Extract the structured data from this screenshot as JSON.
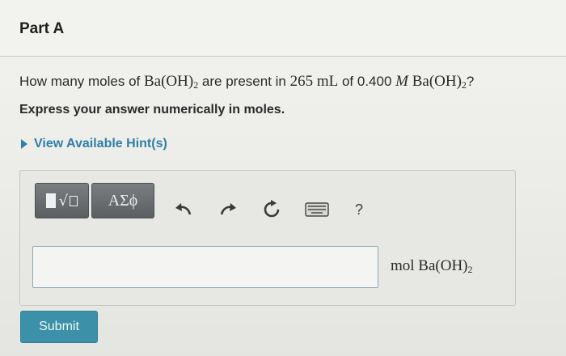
{
  "part": {
    "title": "Part A"
  },
  "question": {
    "prefix": "How many moles of ",
    "compound_base": "Ba(OH)",
    "compound_sub": "2",
    "middle": " are present in ",
    "volume": "265 mL",
    "of_text": " of ",
    "concentration": "0.400 ",
    "molar_symbol": "M",
    "suffix": "?"
  },
  "instruction": "Express your answer numerically in moles.",
  "hint": {
    "label": "View Available Hint(s)"
  },
  "toolbar": {
    "greek_label": "ΑΣϕ",
    "help_label": "?",
    "icons": [
      "templates-icon",
      "undo-icon",
      "redo-icon",
      "reset-icon",
      "keyboard-icon",
      "help-icon"
    ]
  },
  "answer": {
    "value": "",
    "unit_base": "mol Ba(OH)",
    "unit_sub": "2"
  },
  "submit": {
    "label": "Submit"
  },
  "colors": {
    "accent": "#3c91a8",
    "link": "#2f7fa8",
    "toolbar": "#62666a"
  }
}
